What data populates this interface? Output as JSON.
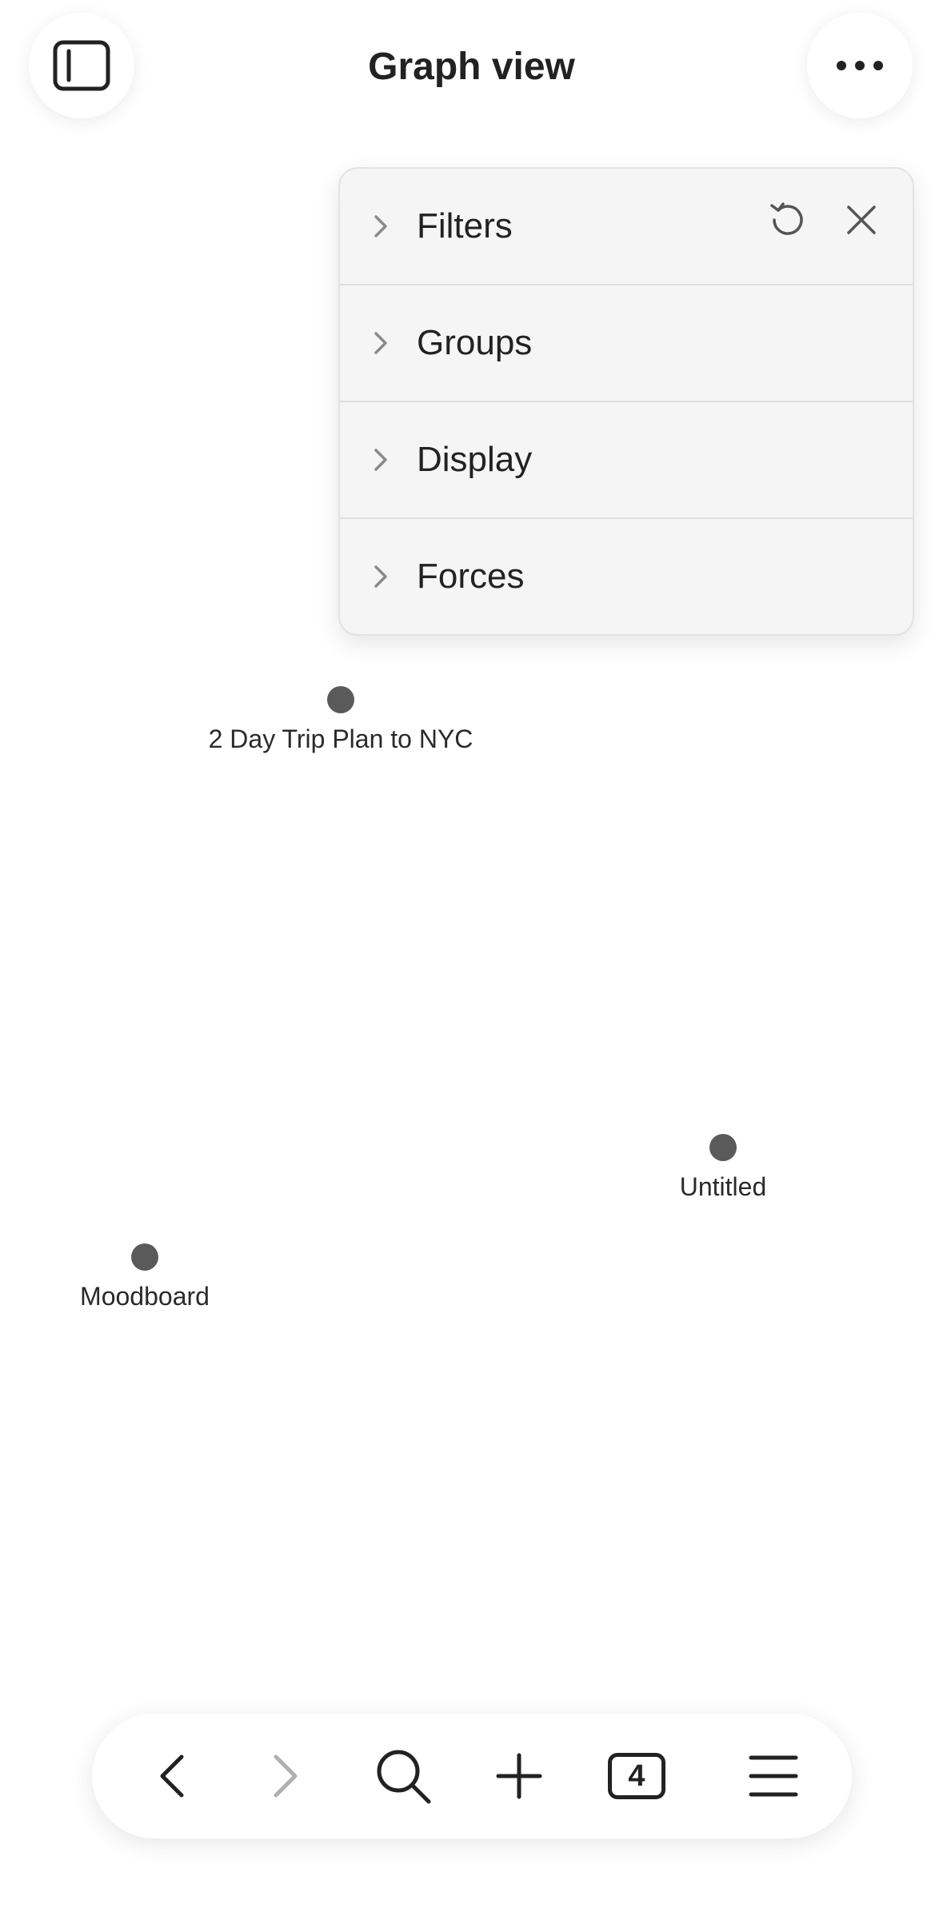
{
  "header": {
    "title": "Graph view",
    "sidebar_toggle_icon": "sidebar-icon",
    "more_icon": "more-dots-icon"
  },
  "panel": {
    "sections": [
      {
        "label": "Filters"
      },
      {
        "label": "Groups"
      },
      {
        "label": "Display"
      },
      {
        "label": "Forces"
      }
    ],
    "reset_icon": "reset-icon",
    "close_icon": "close-icon"
  },
  "graph": {
    "nodes": [
      {
        "label": "2 Day Trip Plan to NYC"
      },
      {
        "label": "Untitled"
      },
      {
        "label": "Moodboard"
      }
    ],
    "node_color": "#5a5a5a"
  },
  "toolbar": {
    "back_icon": "back-chevron-icon",
    "forward_icon": "forward-chevron-icon",
    "search_icon": "search-icon",
    "new_icon": "plus-icon",
    "tab_count": "4",
    "menu_icon": "menu-icon"
  },
  "colors": {
    "background": "#ffffff",
    "panel_bg": "#f5f5f5",
    "text": "#222222",
    "disabled": "#b0b0b0"
  }
}
